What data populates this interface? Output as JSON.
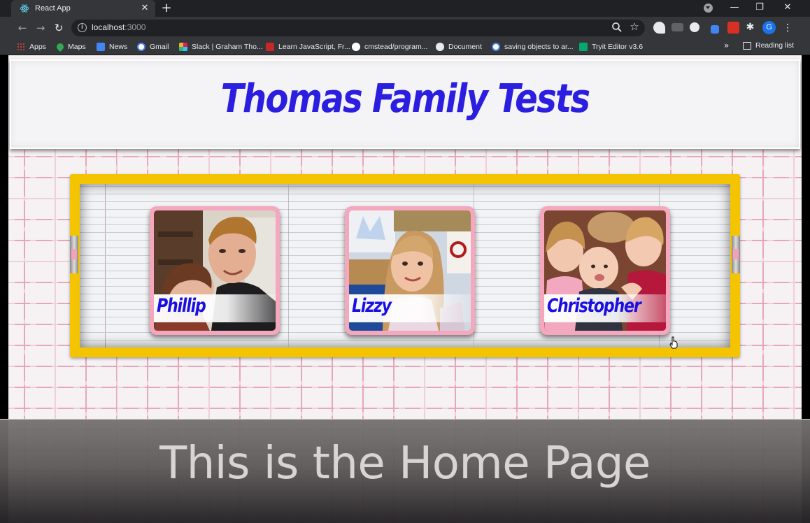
{
  "browser": {
    "tab": {
      "title": "React App",
      "icon": "react-icon"
    },
    "new_tab_label": "+",
    "address": {
      "host": "localhost",
      "port": ":3000"
    },
    "bookmarks": [
      {
        "label": "Apps",
        "icon": "apps-grid-icon",
        "color": "#e34c26"
      },
      {
        "label": "Maps",
        "icon": "maps-pin-icon",
        "color": "#34a853"
      },
      {
        "label": "News",
        "icon": "news-icon",
        "color": "#4285f4"
      },
      {
        "label": "Gmail",
        "icon": "google-icon",
        "color": "#ffffff"
      },
      {
        "label": "Slack | Graham Tho...",
        "icon": "slack-icon",
        "color": "#e01e5a"
      },
      {
        "label": "Learn JavaScript, Fr...",
        "icon": "freecodecamp-icon",
        "color": "#c62828"
      },
      {
        "label": "cmstead/program...",
        "icon": "github-icon",
        "color": "#ffffff"
      },
      {
        "label": "Document",
        "icon": "document-globe-icon",
        "color": "#e8eaed"
      },
      {
        "label": "saving objects to ar...",
        "icon": "google-icon",
        "color": "#ffffff"
      },
      {
        "label": "Tryit Editor v3.6",
        "icon": "w3schools-icon",
        "color": "#04aa6d"
      }
    ],
    "more_bookmarks": "»",
    "reading_list": "Reading list",
    "profile_initial": "G"
  },
  "page": {
    "title": "Thomas Family Tests",
    "members": [
      {
        "name": "Phillip"
      },
      {
        "name": "Lizzy"
      },
      {
        "name": "Christopher"
      }
    ]
  },
  "caption": "This is the Home Page",
  "colors": {
    "title_blue": "#2b1ee0",
    "frame_yellow": "#f5c400",
    "card_pink": "#f4a7bd",
    "maze_pink": "#e7a3b8"
  }
}
